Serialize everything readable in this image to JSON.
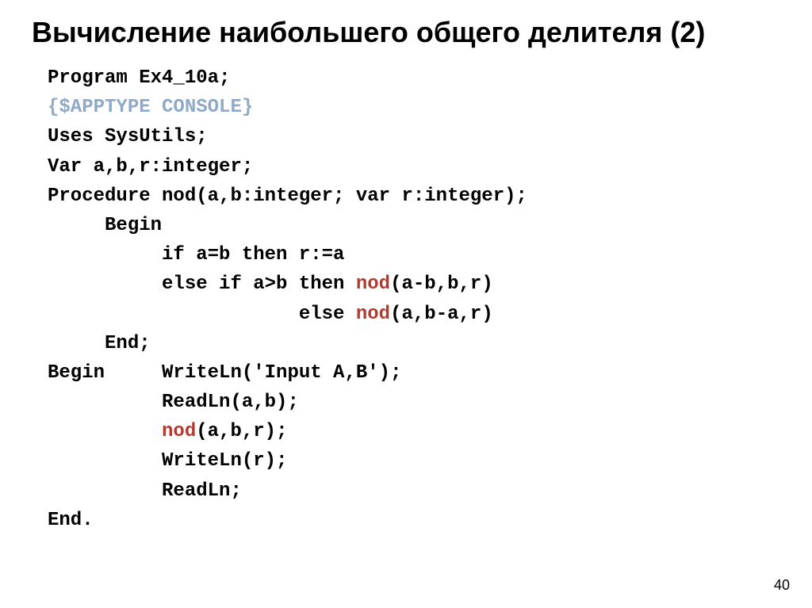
{
  "title": "Вычисление наибольшего общего делителя (2)",
  "page_number": "40",
  "code": {
    "l1": "Program Ex4_10a;",
    "l2": "{$APPTYPE CONSOLE}",
    "l3": "Uses SysUtils;",
    "l4": "Var a,b,r:integer;",
    "l5": "Procedure nod(a,b:integer; var r:integer);",
    "l6": "     Begin",
    "l7": "          if a=b then r:=a",
    "l8a": "          else if a>b then ",
    "l8b": "nod",
    "l8c": "(a-b,b,r)",
    "l9a": "                      else ",
    "l9b": "nod",
    "l9c": "(a,b-a,r)",
    "l10": "     End;",
    "l11": "Begin     WriteLn('Input A,B');",
    "l12": "          ReadLn(a,b);",
    "l13a": "          ",
    "l13b": "nod",
    "l13c": "(a,b,r);",
    "l14": "          WriteLn(r);",
    "l15": "          ReadLn;",
    "l16": "End."
  }
}
